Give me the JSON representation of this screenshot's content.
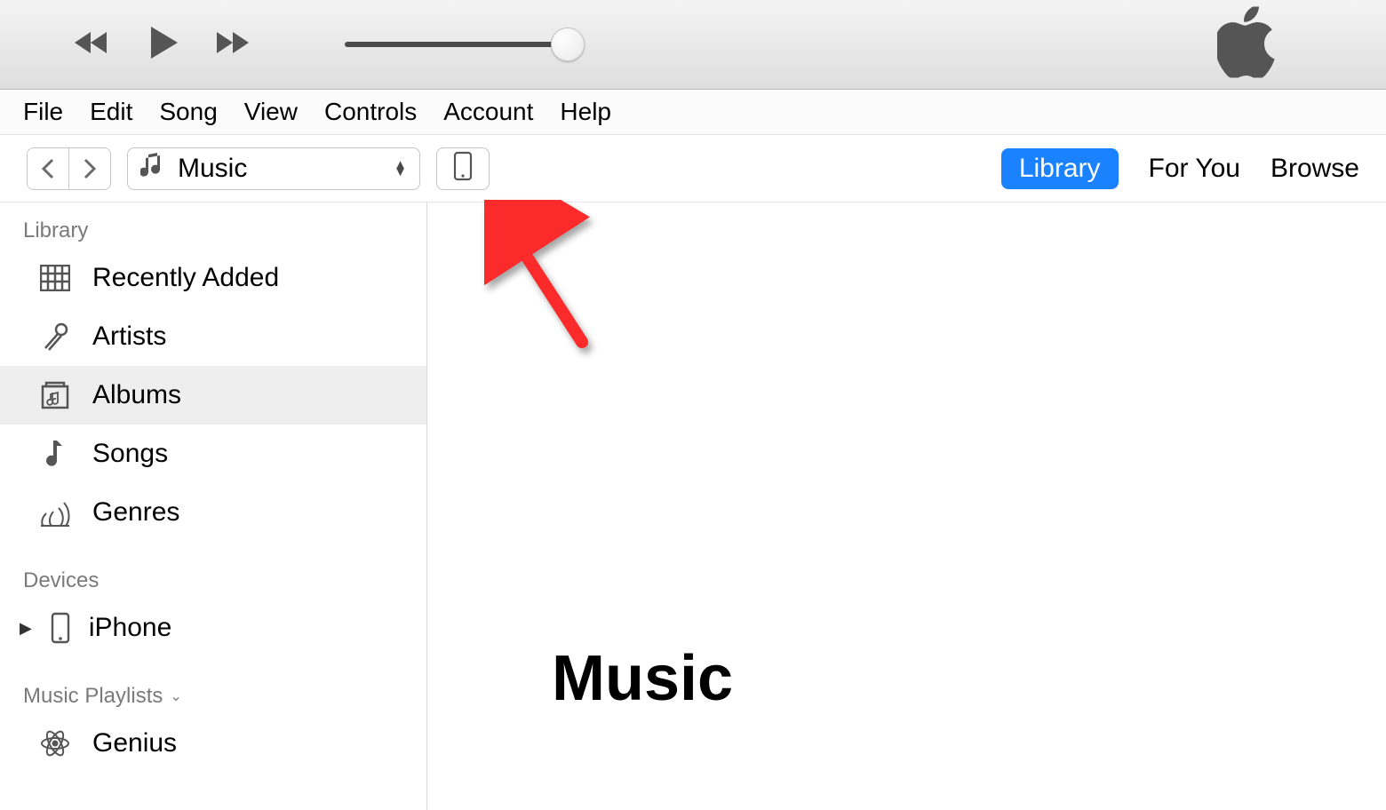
{
  "menu": {
    "items": [
      "File",
      "Edit",
      "Song",
      "View",
      "Controls",
      "Account",
      "Help"
    ]
  },
  "toolbar": {
    "media_label": "Music"
  },
  "tabs": {
    "library": "Library",
    "for_you": "For You",
    "browse": "Browse",
    "active": "library"
  },
  "sidebar": {
    "library_heading": "Library",
    "library_items": [
      {
        "id": "recently-added",
        "label": "Recently Added"
      },
      {
        "id": "artists",
        "label": "Artists"
      },
      {
        "id": "albums",
        "label": "Albums",
        "selected": true
      },
      {
        "id": "songs",
        "label": "Songs"
      },
      {
        "id": "genres",
        "label": "Genres"
      }
    ],
    "devices_heading": "Devices",
    "devices": [
      {
        "id": "iphone",
        "label": "iPhone"
      }
    ],
    "playlists_heading": "Music Playlists",
    "playlists": [
      {
        "id": "genius",
        "label": "Genius"
      }
    ]
  },
  "main": {
    "title": "Music"
  },
  "colors": {
    "accent": "#1a81ff",
    "annotation": "#fc2b2b"
  }
}
